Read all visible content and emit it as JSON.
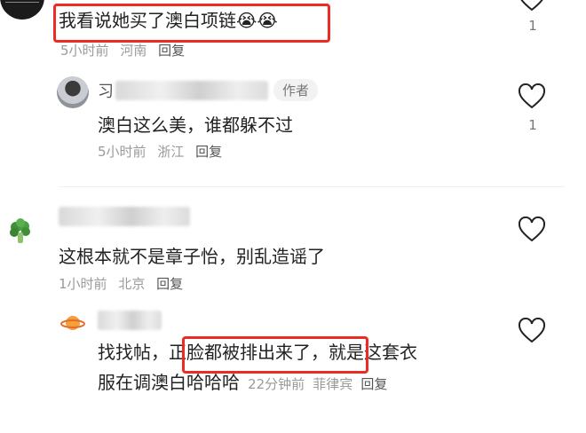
{
  "comments": [
    {
      "text": "我看说她买了澳白项链",
      "emoji": "😭😭",
      "time": "5小时前",
      "location": "河南",
      "reply_label": "回复",
      "likes": "1",
      "reply": {
        "author_tag": "作者",
        "text": "澳白这么美，谁都躲不过",
        "time": "5小时前",
        "location": "浙江",
        "reply_label": "回复",
        "likes": "1"
      }
    },
    {
      "text": "这根本就不是章子怡，别乱造谣了",
      "time": "1小时前",
      "location": "北京",
      "reply_label": "回复",
      "reply": {
        "text_pre": "找找帖，",
        "text_highlight": "正脸都被排出来了",
        "text_post": "，就是这套衣",
        "text_line2": "服在调澳白哈哈哈",
        "time": "22分钟前",
        "location": "菲律宾",
        "reply_label": "回复"
      }
    }
  ],
  "colors": {
    "highlight_box": "#ee2a24",
    "meta": "#9a9a9a"
  },
  "icons": {
    "like": "heart-outline-icon"
  }
}
